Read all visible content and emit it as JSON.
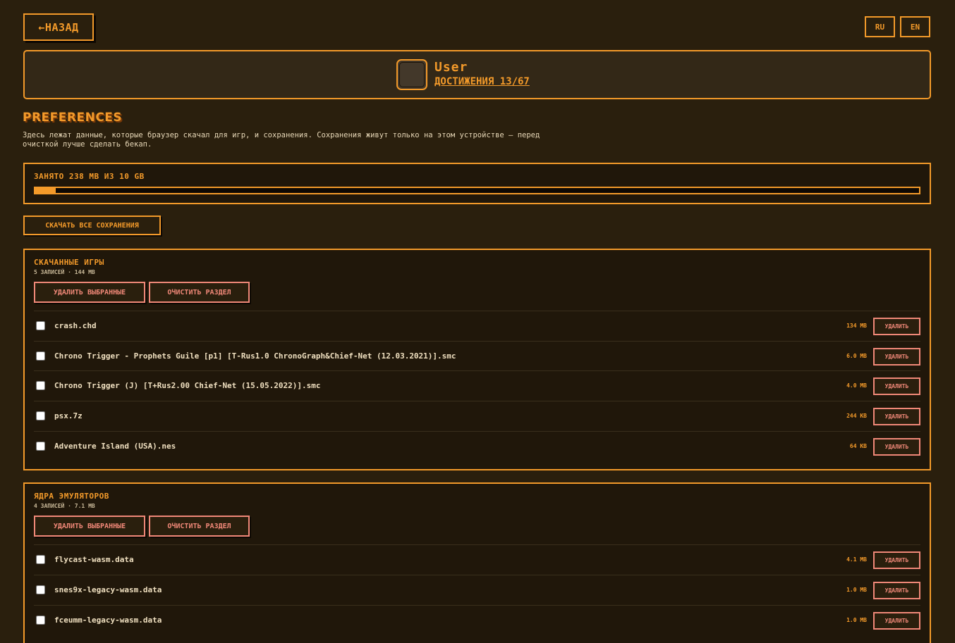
{
  "header": {
    "back_label": "←НАЗАД",
    "lang_ru": "RU",
    "lang_en": "EN"
  },
  "profile": {
    "username": "User",
    "achievements": "ДОСТИЖЕНИЯ 13/67"
  },
  "preferences": {
    "title": "PREFERENCES",
    "description": "Здесь лежат данные, которые браузер скачал для игр, и сохранения. Сохранения живут только на этом устройстве — перед очисткой лучше сделать бекап."
  },
  "storage": {
    "label": "ЗАНЯТО 238 MB ИЗ 10 GB",
    "used_fraction": 0.023
  },
  "download_all_label": "СКАЧАТЬ ВСЕ СОХРАНЕНИЯ",
  "sections": {
    "games": {
      "title": "СКАЧАННЫЕ ИГРЫ",
      "meta": "5 ЗАПИСЕЙ · 144 MB",
      "delete_selected": "УДАЛИТЬ ВЫБРАННЫЕ",
      "clear_section": "ОЧИСТИТЬ РАЗДЕЛ",
      "items": [
        {
          "name": "crash.chd",
          "size": "134 MB",
          "delete": "УДАЛИТЬ"
        },
        {
          "name": "Chrono Trigger - Prophets Guile [p1] [T-Rus1.0 ChronoGraph&Chief-Net (12.03.2021)].smc",
          "size": "6.0 MB",
          "delete": "УДАЛИТЬ"
        },
        {
          "name": "Chrono Trigger (J) [T+Rus2.00 Chief-Net (15.05.2022)].smc",
          "size": "4.0 MB",
          "delete": "УДАЛИТЬ"
        },
        {
          "name": "psx.7z",
          "size": "244 KB",
          "delete": "УДАЛИТЬ"
        },
        {
          "name": "Adventure Island (USA).nes",
          "size": "64 KB",
          "delete": "УДАЛИТЬ"
        }
      ]
    },
    "cores": {
      "title": "ЯДРА ЭМУЛЯТОРОВ",
      "meta": "4 ЗАПИСЕЙ · 7.1 MB",
      "delete_selected": "УДАЛИТЬ ВЫБРАННЫЕ",
      "clear_section": "ОЧИСТИТЬ РАЗДЕЛ",
      "items": [
        {
          "name": "flycast-wasm.data",
          "size": "4.1 MB",
          "delete": "УДАЛИТЬ"
        },
        {
          "name": "snes9x-legacy-wasm.data",
          "size": "1.0 MB",
          "delete": "УДАЛИТЬ"
        },
        {
          "name": "fceumm-legacy-wasm.data",
          "size": "1.0 MB",
          "delete": "УДАЛИТЬ"
        }
      ]
    }
  },
  "colors": {
    "background": "#2a1f0d",
    "accent": "#f39a2a",
    "danger": "#f08878"
  }
}
